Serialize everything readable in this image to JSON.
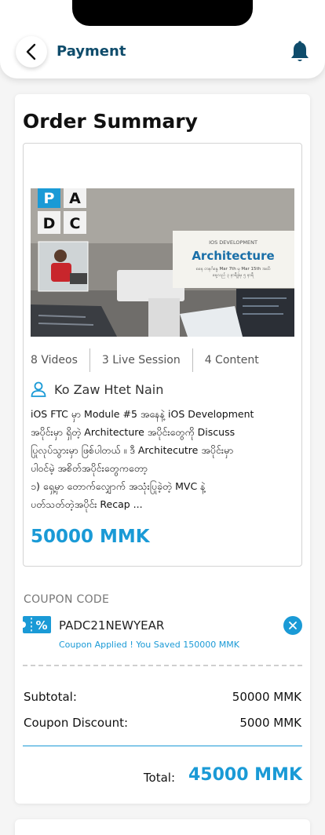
{
  "header": {
    "title": "Payment",
    "back_icon": "chevron-left-icon",
    "notification_icon": "bell-icon"
  },
  "order": {
    "title": "Order Summary",
    "course": {
      "banner": {
        "logo_letters": [
          "P",
          "A",
          "D",
          "C"
        ],
        "tag": "IOS DEVELOPMENT",
        "headline": "Architecture",
        "subtitle_line1": "စနေ တနင်္ဂနွေ Mar 7th မှ Mar 15th အထိ",
        "subtitle_line2": "နေ့လည် ၃ နာရီခွဲမှ ၅ နာရီ"
      },
      "stats": [
        "8 Videos",
        "3 Live Session",
        "4 Content"
      ],
      "instructor": "Ko Zaw Htet Naing",
      "description_lines": [
        "iOS FTC မှာ Module #5 အနေနဲ့ iOS Development",
        "အပိုင်းမှာ ရှိတဲ့ Architecture အပိုင်းတွေကို Discuss",
        "ပြုလုပ်သွားမှာ ဖြစ်ပါတယ် ။ ဒီ Architecutre အပိုင်းမှာ",
        "ပါဝင်မဲ့ အစိတ်အပိုင်းတွေကတော့",
        "၁) ရှေ့မှာ တောက်လျှောက် အသုံးပြုခဲ့တဲ့ MVC နဲ့",
        "ပတ်သတ်တဲ့အပိုင်း Recap ..."
      ],
      "price": "50000 MMK"
    },
    "coupon": {
      "label": "COUPON CODE",
      "code": "PADC21NEWYEAR",
      "applied_message": "Coupon Applied ! You Saved 150000 MMK"
    },
    "subtotal": {
      "label": "Subtotal:",
      "value": "50000 MMK"
    },
    "discount": {
      "label": "Coupon Discount:",
      "value": "5000 MMK"
    },
    "total": {
      "label": "Total:",
      "value": "45000 MMK"
    }
  },
  "colors": {
    "accent": "#1a9ad6",
    "header_title": "#0f4c6b",
    "background": "#f5f5f5"
  }
}
